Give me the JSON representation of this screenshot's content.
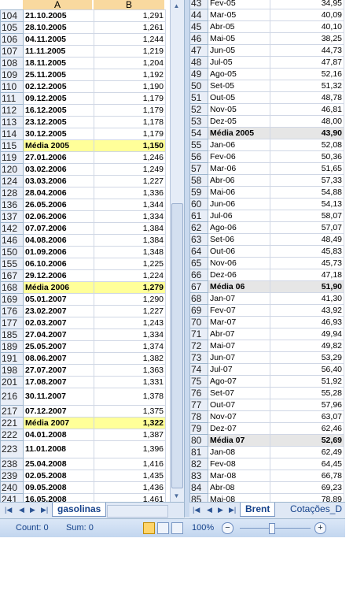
{
  "left_sheet": {
    "col_a_header": "A",
    "col_b_header": "B",
    "rows": [
      {
        "row": "104",
        "date": "21.10.2005",
        "value": "1,291"
      },
      {
        "row": "105",
        "date": "28.10.2005",
        "value": "1,261"
      },
      {
        "row": "106",
        "date": "04.11.2005",
        "value": "1,244"
      },
      {
        "row": "107",
        "date": "11.11.2005",
        "value": "1,219"
      },
      {
        "row": "108",
        "date": "18.11.2005",
        "value": "1,204"
      },
      {
        "row": "109",
        "date": "25.11.2005",
        "value": "1,192"
      },
      {
        "row": "110",
        "date": "02.12.2005",
        "value": "1,190"
      },
      {
        "row": "111",
        "date": "09.12.2005",
        "value": "1,179"
      },
      {
        "row": "112",
        "date": "16.12.2005",
        "value": "1,179"
      },
      {
        "row": "113",
        "date": "23.12.2005",
        "value": "1,178"
      },
      {
        "row": "114",
        "date": "30.12.2005",
        "value": "1,179"
      },
      {
        "row": "115",
        "date": "Média 2005",
        "value": "1,150",
        "avg": true
      },
      {
        "row": "119",
        "date": "27.01.2006",
        "value": "1,246"
      },
      {
        "row": "120",
        "date": "03.02.2006",
        "value": "1,249"
      },
      {
        "row": "124",
        "date": "03.03.2006",
        "value": "1,227"
      },
      {
        "row": "128",
        "date": "28.04.2006",
        "value": "1,336"
      },
      {
        "row": "136",
        "date": "26.05.2006",
        "value": "1,344"
      },
      {
        "row": "137",
        "date": "02.06.2006",
        "value": "1,334"
      },
      {
        "row": "142",
        "date": "07.07.2006",
        "value": "1,384"
      },
      {
        "row": "146",
        "date": "04.08.2006",
        "value": "1,384"
      },
      {
        "row": "150",
        "date": "01.09.2006",
        "value": "1,348"
      },
      {
        "row": "155",
        "date": "06.10.2006",
        "value": "1,225"
      },
      {
        "row": "167",
        "date": "29.12.2006",
        "value": "1,224"
      },
      {
        "row": "168",
        "date": "Média 2006",
        "value": "1,279",
        "avg": true
      },
      {
        "row": "169",
        "date": "05.01.2007",
        "value": "1,290"
      },
      {
        "row": "176",
        "date": "23.02.2007",
        "value": "1,227"
      },
      {
        "row": "177",
        "date": "02.03.2007",
        "value": "1,243"
      },
      {
        "row": "185",
        "date": "27.04.2007",
        "value": "1,334"
      },
      {
        "row": "189",
        "date": "25.05.2007",
        "value": "1,374"
      },
      {
        "row": "191",
        "date": "08.06.2007",
        "value": "1,382"
      },
      {
        "row": "198",
        "date": "27.07.2007",
        "value": "1,363"
      },
      {
        "row": "201",
        "date": "17.08.2007",
        "value": "1,331"
      },
      {
        "row": "216",
        "date": "30.11.2007",
        "value": "1,378",
        "tall": true
      },
      {
        "row": "217",
        "date": "07.12.2007",
        "value": "1,375"
      },
      {
        "row": "221",
        "date": "Média  2007",
        "value": "1,322",
        "avg": true
      },
      {
        "row": "222",
        "date": "04.01.2008",
        "value": "1,387"
      },
      {
        "row": "223",
        "date": "11.01.2008",
        "value": "1,396",
        "tall": true
      },
      {
        "row": "238",
        "date": "25.04.2008",
        "value": "1,416"
      },
      {
        "row": "239",
        "date": "02.05.2008",
        "value": "1,435"
      },
      {
        "row": "240",
        "date": "09.05.2008",
        "value": "1,436"
      },
      {
        "row": "241",
        "date": "16.05.2008",
        "value": "1,461"
      }
    ],
    "sheet_tab": "gasolinas"
  },
  "right_sheet": {
    "rows": [
      {
        "row": "43",
        "month": "Fev-05",
        "value": "34,95"
      },
      {
        "row": "44",
        "month": "Mar-05",
        "value": "40,09"
      },
      {
        "row": "45",
        "month": "Abr-05",
        "value": "40,10"
      },
      {
        "row": "46",
        "month": "Mai-05",
        "value": "38,25"
      },
      {
        "row": "47",
        "month": "Jun-05",
        "value": "44,73"
      },
      {
        "row": "48",
        "month": "Jul-05",
        "value": "47,87"
      },
      {
        "row": "49",
        "month": "Ago-05",
        "value": "52,16"
      },
      {
        "row": "50",
        "month": "Set-05",
        "value": "51,32"
      },
      {
        "row": "51",
        "month": "Out-05",
        "value": "48,78"
      },
      {
        "row": "52",
        "month": "Nov-05",
        "value": "46,81"
      },
      {
        "row": "53",
        "month": "Dez-05",
        "value": "48,00"
      },
      {
        "row": "54",
        "month": "Média 2005",
        "value": "43,90",
        "avg": true
      },
      {
        "row": "55",
        "month": "Jan-06",
        "value": "52,08"
      },
      {
        "row": "56",
        "month": "Fev-06",
        "value": "50,36"
      },
      {
        "row": "57",
        "month": "Mar-06",
        "value": "51,65"
      },
      {
        "row": "58",
        "month": "Abr-06",
        "value": "57,33"
      },
      {
        "row": "59",
        "month": "Mai-06",
        "value": "54,88"
      },
      {
        "row": "60",
        "month": "Jun-06",
        "value": "54,13"
      },
      {
        "row": "61",
        "month": "Jul-06",
        "value": "58,07"
      },
      {
        "row": "62",
        "month": "Ago-06",
        "value": "57,07"
      },
      {
        "row": "63",
        "month": "Set-06",
        "value": "48,49"
      },
      {
        "row": "64",
        "month": "Out-06",
        "value": "45,83"
      },
      {
        "row": "65",
        "month": "Nov-06",
        "value": "45,73"
      },
      {
        "row": "66",
        "month": "Dez-06",
        "value": "47,18"
      },
      {
        "row": "67",
        "month": "Média 06",
        "value": "51,90",
        "avg": true
      },
      {
        "row": "68",
        "month": "Jan-07",
        "value": "41,30"
      },
      {
        "row": "69",
        "month": "Fev-07",
        "value": "43,92"
      },
      {
        "row": "70",
        "month": "Mar-07",
        "value": "46,93"
      },
      {
        "row": "71",
        "month": "Abr-07",
        "value": "49,94"
      },
      {
        "row": "72",
        "month": "Mai-07",
        "value": "49,82"
      },
      {
        "row": "73",
        "month": "Jun-07",
        "value": "53,29"
      },
      {
        "row": "74",
        "month": "Jul-07",
        "value": "56,40"
      },
      {
        "row": "75",
        "month": "Ago-07",
        "value": "51,92"
      },
      {
        "row": "76",
        "month": "Set-07",
        "value": "55,28"
      },
      {
        "row": "77",
        "month": "Out-07",
        "value": "57,96"
      },
      {
        "row": "78",
        "month": "Nov-07",
        "value": "63,07"
      },
      {
        "row": "79",
        "month": "Dez-07",
        "value": "62,46"
      },
      {
        "row": "80",
        "month": "Média 07",
        "value": "52,69",
        "avg": true
      },
      {
        "row": "81",
        "month": "Jan-08",
        "value": "62,49"
      },
      {
        "row": "82",
        "month": "Fev-08",
        "value": "64,45"
      },
      {
        "row": "83",
        "month": "Mar-08",
        "value": "66,78"
      },
      {
        "row": "84",
        "month": "Abr-08",
        "value": "69,23"
      },
      {
        "row": "85",
        "month": "Mai-08",
        "value": "78,89"
      }
    ],
    "sheet_tab_active": "Brent",
    "sheet_tab_next": "Cotações_D"
  },
  "status_bar": {
    "count_label": "Count: 0",
    "sum_label": "Sum: 0",
    "zoom": "100%",
    "zoom_out": "−",
    "zoom_in": "+"
  },
  "colors": {
    "avg_highlight_left": "#ffff99",
    "avg_highlight_right": "#e6e6e6",
    "header_selected": "#f9d99f",
    "status_bar": "#c2d6ef"
  }
}
